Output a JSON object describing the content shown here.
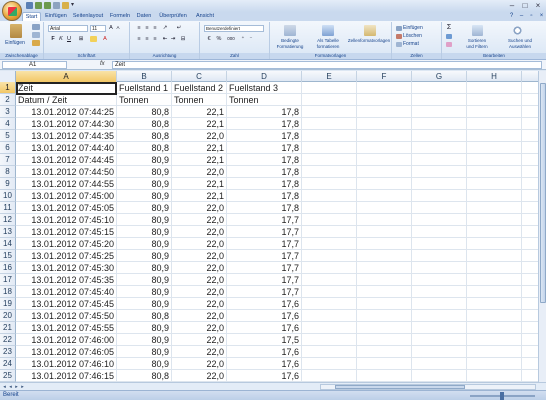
{
  "title_bar": {
    "icons": [
      "save-icon",
      "undo-icon",
      "redo-icon",
      "print-icon",
      "open-icon",
      "dropdown-icon"
    ],
    "controls": [
      "minimize",
      "maximize",
      "close"
    ]
  },
  "tabs": [
    "Start",
    "Einfügen",
    "Seitenlayout",
    "Formeln",
    "Daten",
    "Überprüfen",
    "Ansicht"
  ],
  "active_tab": "Start",
  "ribbon": {
    "clipboard": {
      "paste_label": "Einfügen",
      "group_label": "Zwischenablage"
    },
    "font": {
      "font_name": "Arial",
      "font_size": "11",
      "bold": "F",
      "italic": "K",
      "underline": "U",
      "group_label": "Schriftart"
    },
    "alignment": {
      "group_label": "Ausrichtung"
    },
    "number": {
      "format": "Benutzerdefiniert",
      "percent": "%",
      "thousands": "000",
      "group_label": "Zahl"
    },
    "styles": {
      "conditional": "Bedingte\nFormatierung",
      "as_table": "Als Tabelle\nformatieren",
      "cell_styles": "Zellenformatvorlagen",
      "group_label": "Formatvorlagen"
    },
    "cells": {
      "insert": "Einfügen",
      "delete": "Löschen",
      "format": "Format",
      "group_label": "Zellen"
    },
    "editing": {
      "sum": "Σ",
      "sort": "Sortieren\nund Filtern",
      "find": "Suchen und\nAuswählen",
      "group_label": "Bearbeiten"
    }
  },
  "formula_bar": {
    "name_box": "A1",
    "fx": "fx",
    "content": "Zeit"
  },
  "columns": [
    "A",
    "B",
    "C",
    "D",
    "E",
    "F",
    "G",
    "H"
  ],
  "rows": [
    [
      "1",
      "Zeit",
      "Fuellstand 1",
      "Fuellstand 2",
      "Fuellstand 3"
    ],
    [
      "2",
      "Datum / Zeit",
      "Tonnen",
      "Tonnen",
      "Tonnen"
    ],
    [
      "3",
      "13.01.2012 07:44:25",
      "80,8",
      "22,1",
      "17,8"
    ],
    [
      "4",
      "13.01.2012 07:44:30",
      "80,8",
      "22,1",
      "17,8"
    ],
    [
      "5",
      "13.01.2012 07:44:35",
      "80,8",
      "22,0",
      "17,8"
    ],
    [
      "6",
      "13.01.2012 07:44:40",
      "80,8",
      "22,1",
      "17,8"
    ],
    [
      "7",
      "13.01.2012 07:44:45",
      "80,9",
      "22,1",
      "17,8"
    ],
    [
      "8",
      "13.01.2012 07:44:50",
      "80,9",
      "22,0",
      "17,8"
    ],
    [
      "9",
      "13.01.2012 07:44:55",
      "80,9",
      "22,1",
      "17,8"
    ],
    [
      "10",
      "13.01.2012 07:45:00",
      "80,9",
      "22,1",
      "17,8"
    ],
    [
      "11",
      "13.01.2012 07:45:05",
      "80,9",
      "22,0",
      "17,8"
    ],
    [
      "12",
      "13.01.2012 07:45:10",
      "80,9",
      "22,0",
      "17,7"
    ],
    [
      "13",
      "13.01.2012 07:45:15",
      "80,9",
      "22,0",
      "17,7"
    ],
    [
      "14",
      "13.01.2012 07:45:20",
      "80,9",
      "22,0",
      "17,7"
    ],
    [
      "15",
      "13.01.2012 07:45:25",
      "80,9",
      "22,0",
      "17,7"
    ],
    [
      "16",
      "13.01.2012 07:45:30",
      "80,9",
      "22,0",
      "17,7"
    ],
    [
      "17",
      "13.01.2012 07:45:35",
      "80,9",
      "22,0",
      "17,7"
    ],
    [
      "18",
      "13.01.2012 07:45:40",
      "80,9",
      "22,0",
      "17,7"
    ],
    [
      "19",
      "13.01.2012 07:45:45",
      "80,9",
      "22,0",
      "17,6"
    ],
    [
      "20",
      "13.01.2012 07:45:50",
      "80,8",
      "22,0",
      "17,6"
    ],
    [
      "21",
      "13.01.2012 07:45:55",
      "80,9",
      "22,0",
      "17,6"
    ],
    [
      "22",
      "13.01.2012 07:46:00",
      "80,9",
      "22,0",
      "17,5"
    ],
    [
      "23",
      "13.01.2012 07:46:05",
      "80,9",
      "22,0",
      "17,6"
    ],
    [
      "24",
      "13.01.2012 07:46:10",
      "80,9",
      "22,0",
      "17,6"
    ],
    [
      "25",
      "13.01.2012 07:46:15",
      "80,8",
      "22,0",
      "17,6"
    ]
  ],
  "status_bar": {
    "text": "Bereit"
  },
  "colors": {
    "accent": "#15428b",
    "selection": "#f2c766",
    "ribbon": "#d9e6f5"
  }
}
